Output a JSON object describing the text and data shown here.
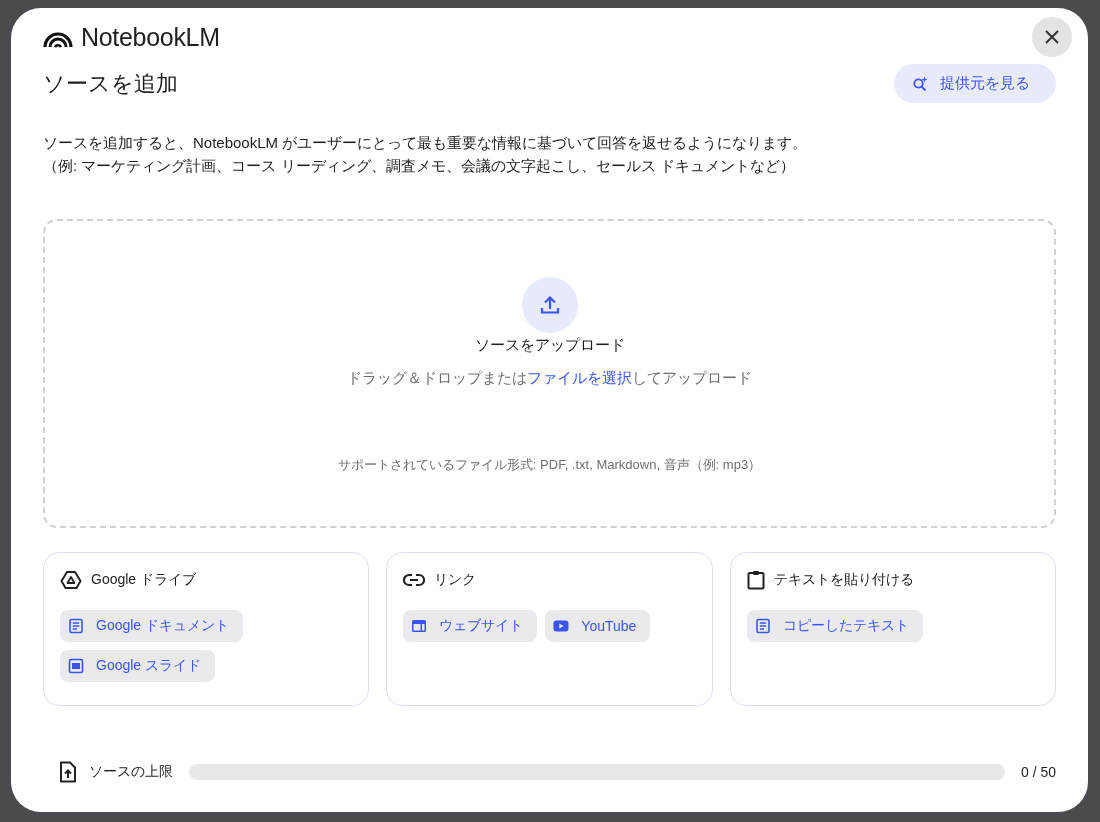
{
  "dialog": {
    "brand": "NotebookLM",
    "title": "ソースを追加",
    "discover_button": "提供元を見る",
    "description": [
      "ソースを追加すると、NotebookLM がユーザーにとって最も重要な情報に基づいて回答を返せるようになります。",
      "（例: マーケティング計画、コース リーディング、調査メモ、会議の文字起こし、セールス ドキュメントなど）"
    ]
  },
  "upload": {
    "title": "ソースをアップロード",
    "hint_before": "ドラッグ＆ドロップまたは",
    "hint_link": "ファイルを選択",
    "hint_after": "してアップロード",
    "formats": "サポートされているファイル形式: PDF, .txt, Markdown, 音声（例: mp3）"
  },
  "source_groups": [
    {
      "kind": "drive",
      "title": "Google ドライブ",
      "options": [
        {
          "kind": "doc",
          "label": "Google ドキュメント"
        },
        {
          "kind": "slides",
          "label": "Google スライド"
        }
      ]
    },
    {
      "kind": "link",
      "title": "リンク",
      "options": [
        {
          "kind": "website",
          "label": "ウェブサイト"
        },
        {
          "kind": "youtube",
          "label": "YouTube"
        }
      ]
    },
    {
      "kind": "paste",
      "title": "テキストを貼り付ける",
      "options": [
        {
          "kind": "doc",
          "label": "コピーしたテキスト"
        }
      ]
    }
  ],
  "source_limit": {
    "label": "ソースの上限",
    "level": 0,
    "count": "0 / 50"
  }
}
